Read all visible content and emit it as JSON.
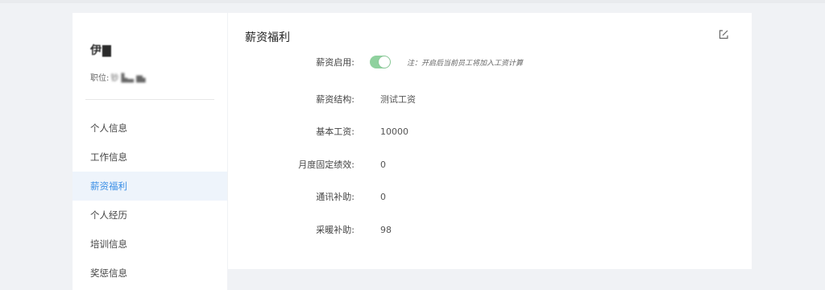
{
  "sidebar": {
    "user_name": "伊▇",
    "role_label": "职位:",
    "role_value": "钞 ▙▃ ▆▖",
    "menu": [
      {
        "label": "个人信息",
        "active": false
      },
      {
        "label": "工作信息",
        "active": false
      },
      {
        "label": "薪资福利",
        "active": true
      },
      {
        "label": "个人经历",
        "active": false
      },
      {
        "label": "培训信息",
        "active": false
      },
      {
        "label": "奖惩信息",
        "active": false
      }
    ]
  },
  "panel": {
    "title": "薪资福利",
    "edit_icon": "edit-icon",
    "salary_enabled": {
      "label": "薪资启用:",
      "value": true,
      "note": "注：开启后当前员工将加入工资计算"
    },
    "structure": {
      "label": "薪资结构:",
      "value": "测试工资"
    },
    "base_salary": {
      "label": "基本工资:",
      "value": "10000"
    },
    "monthly_perf": {
      "label": "月度固定绩效:",
      "value": "0"
    },
    "comm_allowance": {
      "label": "通讯补助:",
      "value": "0"
    },
    "heating_allowance": {
      "label": "采暖补助:",
      "value": "98"
    }
  },
  "colors": {
    "accent": "#3a8ee6",
    "toggle_on": "#8fd19e",
    "active_bg": "#eef4fb"
  }
}
